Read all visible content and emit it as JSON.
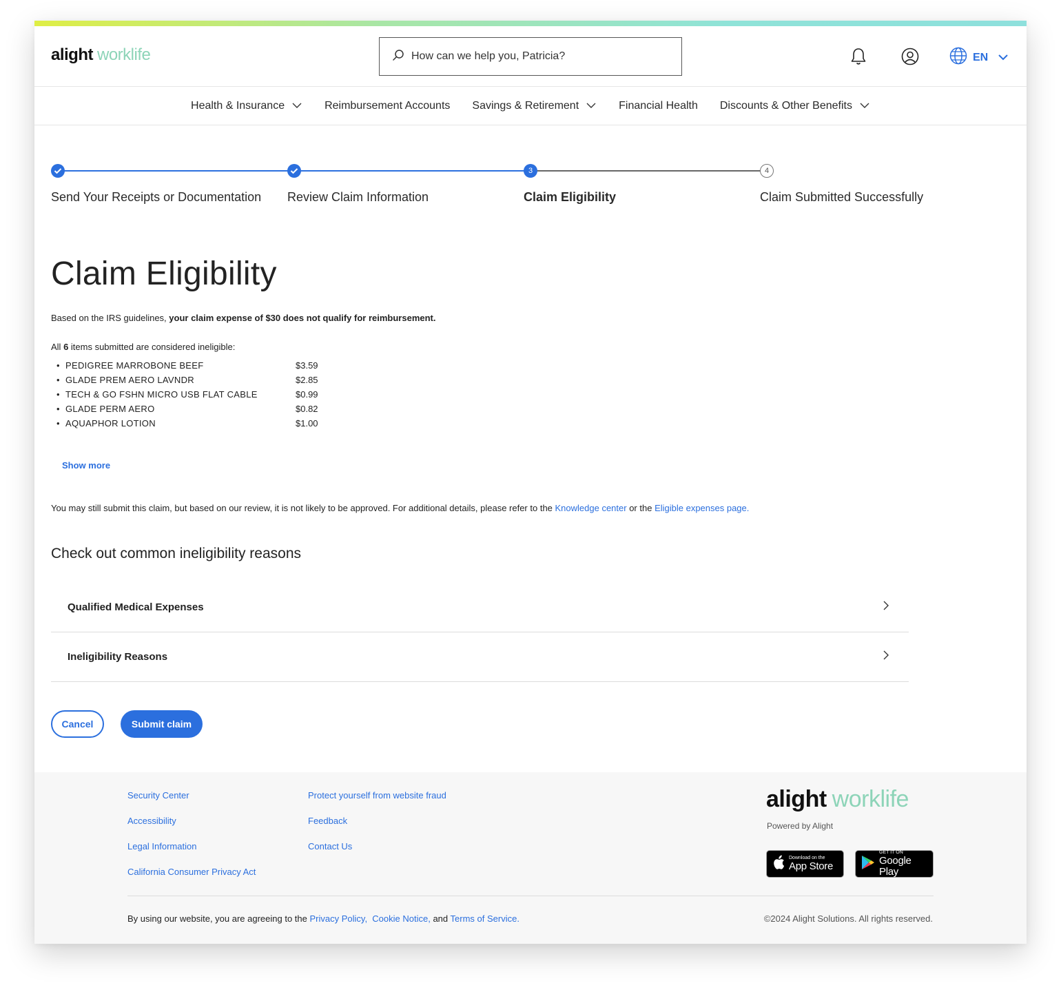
{
  "brand": {
    "primary": "alight",
    "secondary": "worklife",
    "accent": "#2b6fde",
    "worklife_color": "#8dd4b8"
  },
  "header": {
    "search_placeholder": "How can we help you, Patricia?",
    "language": "EN",
    "icons": [
      "search-icon",
      "bell-icon",
      "user-icon",
      "globe-icon",
      "chevron-down-icon"
    ]
  },
  "nav": {
    "items": [
      {
        "label": "Health & Insurance",
        "dropdown": true
      },
      {
        "label": "Reimbursement Accounts",
        "dropdown": false
      },
      {
        "label": "Savings & Retirement",
        "dropdown": true
      },
      {
        "label": "Financial Health",
        "dropdown": false
      },
      {
        "label": "Discounts & Other Benefits",
        "dropdown": true
      }
    ]
  },
  "stepper": {
    "steps": [
      {
        "label": "Send Your Receipts or Documentation",
        "status": "complete",
        "number": "1"
      },
      {
        "label": "Review Claim Information",
        "status": "complete",
        "number": "2"
      },
      {
        "label": "Claim Eligibility",
        "status": "current",
        "number": "3"
      },
      {
        "label": "Claim Submitted Successfully",
        "status": "upcoming",
        "number": "4"
      }
    ]
  },
  "main": {
    "title": "Claim Eligibility",
    "irs_prefix": "Based on the IRS guidelines, ",
    "irs_bold": "your claim expense of $30 does not qualify for reimbursement.",
    "items_prefix": "All ",
    "items_count": "6",
    "items_suffix": " items submitted are considered ineligible:",
    "items": [
      {
        "name": "PEDIGREE MARROBONE BEEF",
        "price": "$3.59"
      },
      {
        "name": "GLADE PREM AERO LAVNDR",
        "price": "$2.85"
      },
      {
        "name": "TECH & GO FSHN MICRO USB FLAT CABLE",
        "price": "$0.99"
      },
      {
        "name": "GLADE PERM AERO",
        "price": "$0.82"
      },
      {
        "name": "AQUAPHOR LOTION",
        "price": "$1.00"
      }
    ],
    "show_more": "Show more",
    "note_prefix": "You may still submit this claim, but based on our review, it is not likely to be approved. For additional details, please refer to the ",
    "knowledge_link": "Knowledge center",
    "note_mid": " or the ",
    "eligible_link": "Eligible expenses page.",
    "reasons_heading": "Check out common ineligibility reasons",
    "accordions": [
      {
        "label": "Qualified Medical Expenses"
      },
      {
        "label": "Ineligibility Reasons"
      }
    ],
    "cancel_label": "Cancel",
    "submit_label": "Submit claim"
  },
  "footer": {
    "col1": [
      "Security Center",
      "Accessibility",
      "Legal Information",
      "California Consumer Privacy Act"
    ],
    "col2": [
      "Protect yourself from website fraud",
      "Feedback",
      "Contact Us"
    ],
    "powered": "Powered by Alight",
    "app_store": {
      "small": "Download on the",
      "big": "App Store"
    },
    "google_play": {
      "small": "GET IT ON",
      "big": "Google Play"
    },
    "agree_prefix": "By using our website, you are agreeing to the ",
    "privacy": "Privacy Policy,",
    "cookie": "Cookie Notice,",
    "and": " and ",
    "terms": "Terms of Service.",
    "copyright": "©2024 Alight Solutions. All rights reserved."
  }
}
